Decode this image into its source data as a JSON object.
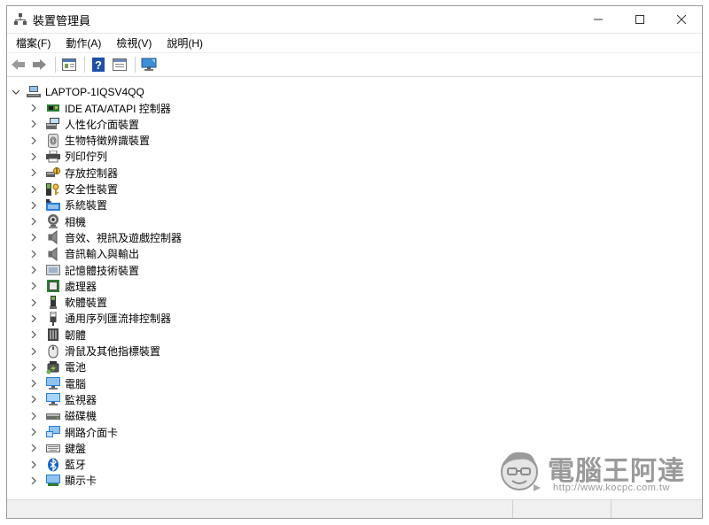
{
  "window": {
    "title": "裝置管理員",
    "controls": {
      "minimize": "—",
      "maximize": "☐",
      "close": "✕"
    }
  },
  "menu": [
    "檔案(F)",
    "動作(A)",
    "檢視(V)",
    "說明(H)"
  ],
  "toolbar": [
    "back-arrow",
    "forward-arrow",
    "properties",
    "help",
    "update-driver",
    "scan-monitor"
  ],
  "tree": {
    "root": "LAPTOP-1IQSV4QQ",
    "items": [
      {
        "label": "IDE ATA/ATAPI 控制器",
        "icon": "ide-controller-icon"
      },
      {
        "label": "人性化介面裝置",
        "icon": "hid-device-icon"
      },
      {
        "label": "生物特徵辨識裝置",
        "icon": "fingerprint-icon"
      },
      {
        "label": "列印佇列",
        "icon": "printer-icon"
      },
      {
        "label": "存放控制器",
        "icon": "storage-controller-icon"
      },
      {
        "label": "安全性裝置",
        "icon": "security-key-icon"
      },
      {
        "label": "系統裝置",
        "icon": "system-folder-icon"
      },
      {
        "label": "相機",
        "icon": "camera-icon"
      },
      {
        "label": "音效、視訊及遊戲控制器",
        "icon": "speaker-icon"
      },
      {
        "label": "音訊輸入與輸出",
        "icon": "speaker-icon"
      },
      {
        "label": "記憶體技術裝置",
        "icon": "memory-icon"
      },
      {
        "label": "處理器",
        "icon": "processor-icon"
      },
      {
        "label": "軟體裝置",
        "icon": "software-device-icon"
      },
      {
        "label": "通用序列匯流排控制器",
        "icon": "usb-icon"
      },
      {
        "label": "韌體",
        "icon": "firmware-icon"
      },
      {
        "label": "滑鼠及其他指標裝置",
        "icon": "mouse-icon"
      },
      {
        "label": "電池",
        "icon": "battery-icon"
      },
      {
        "label": "電腦",
        "icon": "computer-icon"
      },
      {
        "label": "監視器",
        "icon": "monitor-icon"
      },
      {
        "label": "磁碟機",
        "icon": "disk-drive-icon"
      },
      {
        "label": "網路介面卡",
        "icon": "network-adapter-icon"
      },
      {
        "label": "鍵盤",
        "icon": "keyboard-icon"
      },
      {
        "label": "藍牙",
        "icon": "bluetooth-icon"
      },
      {
        "label": "顯示卡",
        "icon": "display-adapter-icon"
      }
    ]
  },
  "watermark": {
    "title": "電腦王阿達",
    "url": "http://www.kocpc.com.tw"
  },
  "colors": {
    "accent": "#2b7cd3",
    "chevron": "#555555",
    "statusbar": "#f0f0f0"
  }
}
